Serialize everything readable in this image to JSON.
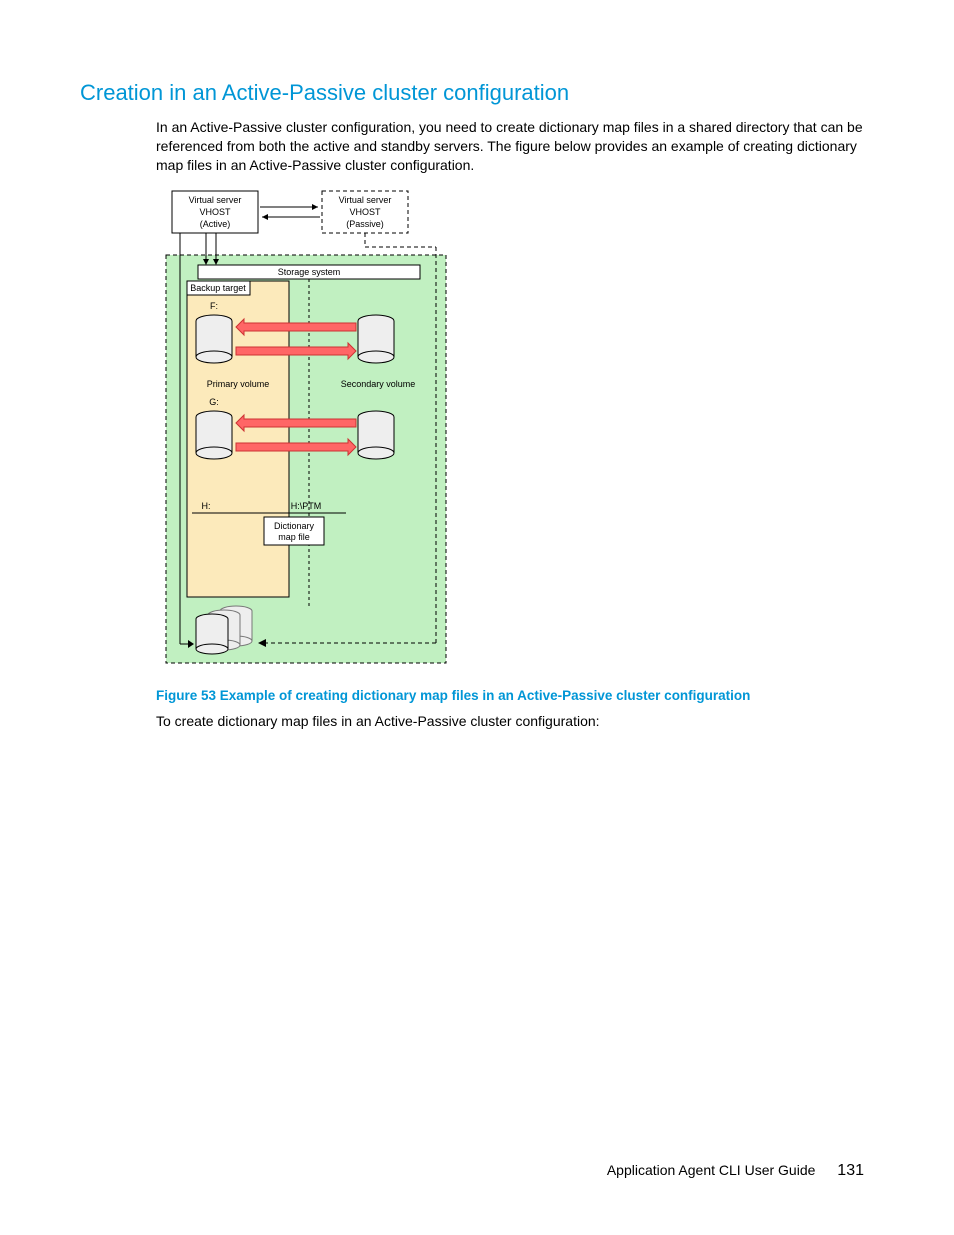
{
  "heading": "Creation in an Active-Passive cluster configuration",
  "intro": "In an Active-Passive cluster configuration, you need to create dictionary map files in a shared directory that can be referenced from both the active and standby servers. The figure below provides an example of creating dictionary map files in an Active-Passive cluster configuration.",
  "figure": {
    "virtual_server_label": "Virtual server",
    "vhost_label": "VHOST",
    "active_label": "(Active)",
    "passive_label": "(Passive)",
    "storage_system": "Storage system",
    "backup_target": "Backup target",
    "drive_f": "F:",
    "drive_g": "G:",
    "drive_h": "H:",
    "primary_volume": "Primary volume",
    "secondary_volume": "Secondary volume",
    "ptm_path": "H:\\PTM",
    "dict_line1": "Dictionary",
    "dict_line2": "map file"
  },
  "caption": "Figure 53 Example of creating dictionary map files in an Active-Passive cluster configuration",
  "post_caption": "To create dictionary map files in an Active-Passive cluster configuration:",
  "footer_title": "Application Agent CLI User Guide",
  "footer_page": "131"
}
